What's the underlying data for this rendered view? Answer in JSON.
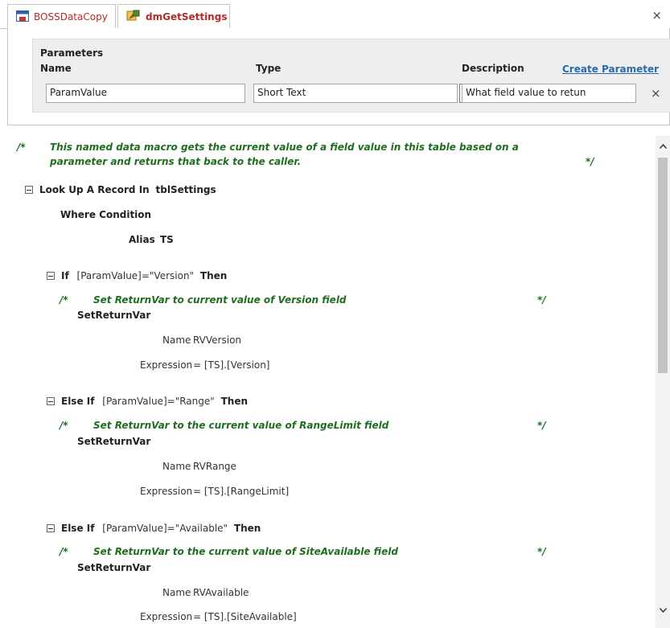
{
  "tabs": [
    {
      "label": "BOSSDataCopy",
      "icon": "table-icon"
    },
    {
      "label": "dmGetSettings",
      "icon": "data-macro-icon"
    }
  ],
  "window": {
    "close_glyph": "×"
  },
  "parameters": {
    "title": "Parameters",
    "headers": {
      "name": "Name",
      "type": "Type",
      "description": "Description"
    },
    "create_link": "Create Parameter",
    "row": {
      "name": "ParamValue",
      "type": "Short Text",
      "description": "What field value to retun"
    },
    "delete_glyph": "×"
  },
  "macro": {
    "intro_comment_1": "This named data macro gets the current value of a field value in this table based on a",
    "intro_comment_2": "parameter and returns that back to the caller.",
    "comment_open": "/*",
    "comment_close": "*/",
    "lookup": {
      "keyword": "Look Up A Record In",
      "table": "tblSettings"
    },
    "where_label": "Where Condition",
    "alias_label": "Alias",
    "alias_value": "TS",
    "blocks": [
      {
        "keyword": "If",
        "condition": "[ParamValue]=\"Version\"",
        "then": "Then",
        "comment": "Set ReturnVar to current value of Version field",
        "action": "SetReturnVar",
        "name_label": "Name",
        "name_value": "RVVersion",
        "expr_label": "Expression",
        "expr_value": "= [TS].[Version]"
      },
      {
        "keyword": "Else If",
        "condition": "[ParamValue]=\"Range\"",
        "then": "Then",
        "comment": "Set ReturnVar to the current value of RangeLimit field",
        "action": "SetReturnVar",
        "name_label": "Name",
        "name_value": "RVRange",
        "expr_label": "Expression",
        "expr_value": "= [TS].[RangeLimit]"
      },
      {
        "keyword": "Else If",
        "condition": "[ParamValue]=\"Available\"",
        "then": "Then",
        "comment": "Set ReturnVar to the current value of SiteAvailable field",
        "action": "SetReturnVar",
        "name_label": "Name",
        "name_value": "RVAvailable",
        "expr_label": "Expression",
        "expr_value": "= [TS].[SiteAvailable]"
      }
    ]
  }
}
